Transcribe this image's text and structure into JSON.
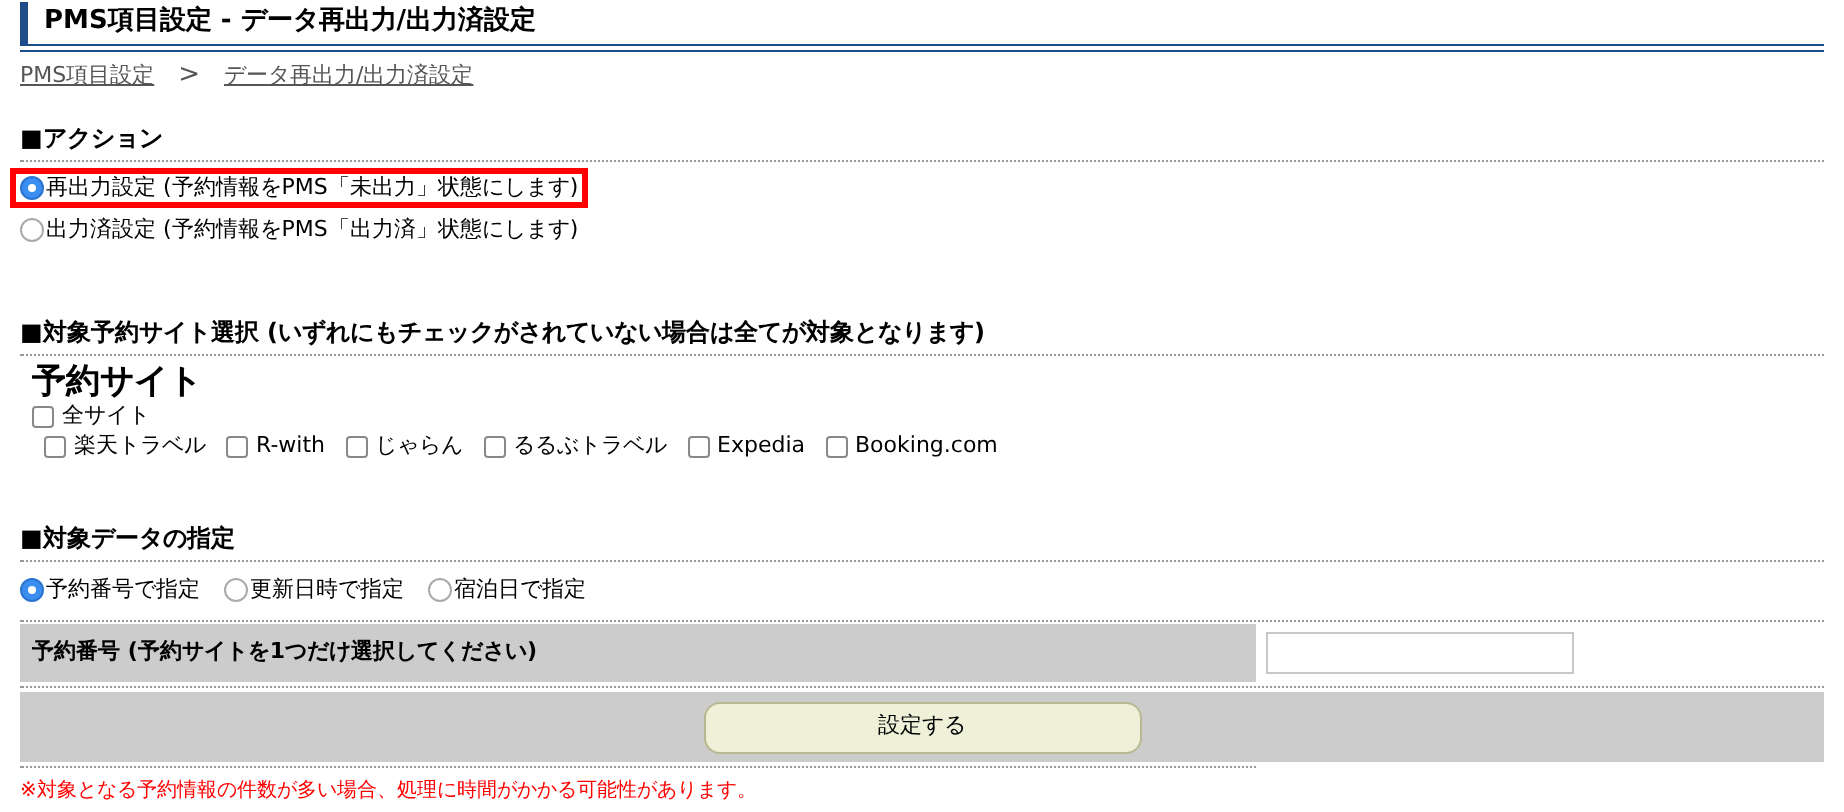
{
  "page_title": "PMS項目設定 - データ再出力/出力済設定",
  "breadcrumb": [
    {
      "label": "PMS項目設定"
    },
    {
      "label": ">",
      "kind": "separator"
    },
    {
      "label": "データ再出力/出力済設定"
    }
  ],
  "action": {
    "heading": "■アクション",
    "options": [
      {
        "label": "再出力設定 (予約情報をPMS「未出力」状態にします)",
        "selected": true,
        "highlighted": true
      },
      {
        "label": "出力済設定 (予約情報をPMS「出力済」状態にします)",
        "selected": false,
        "highlighted": false
      }
    ]
  },
  "sites": {
    "heading": "■対象予約サイト選択 (いずれにもチェックがされていない場合は全てが対象となります)",
    "title": "予約サイト",
    "all": {
      "label": "全サイト",
      "checked": false
    },
    "items": [
      {
        "label": "楽天トラベル",
        "checked": false
      },
      {
        "label": "R-with",
        "checked": false
      },
      {
        "label": "じゃらん",
        "checked": false
      },
      {
        "label": "るるぶトラベル",
        "checked": false
      },
      {
        "label": "Expedia",
        "checked": false
      },
      {
        "label": "Booking.com",
        "checked": false
      }
    ]
  },
  "target": {
    "heading": "■対象データの指定",
    "options": [
      {
        "label": "予約番号で指定",
        "selected": true
      },
      {
        "label": "更新日時で指定",
        "selected": false
      },
      {
        "label": "宿泊日で指定",
        "selected": false
      }
    ],
    "field_label": "予約番号 (予約サイトを1つだけ選択してください)"
  },
  "submit": "設定する",
  "note": "※対象となる予約情報の件数が多い場合、処理に時間がかかる可能性があります。"
}
